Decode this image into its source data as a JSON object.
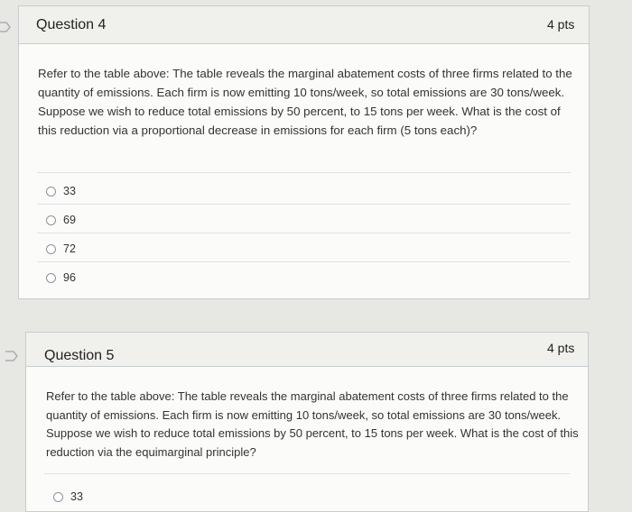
{
  "question4": {
    "title": "Question 4",
    "points": "4 pts",
    "text": "Refer to the table above: The table reveals the marginal abatement costs of three firms related to the quantity of emissions. Each firm is now emitting 10 tons/week, so total emissions are 30 tons/week. Suppose we wish to reduce total emissions by 50 percent, to 15 tons per week. What is the cost of this reduction via a proportional decrease in emissions for each firm (5 tons each)?",
    "options": [
      "33",
      "69",
      "72",
      "96"
    ]
  },
  "question5": {
    "title": "Question 5",
    "points": "4 pts",
    "text": "Refer to the table above: The table reveals the marginal abatement costs of three firms related to the quantity of emissions. Each firm is now emitting 10 tons/week, so total emissions are 30 tons/week. Suppose we wish to reduce total emissions by 50 percent, to 15 tons per week. What is the cost of this reduction via the equimarginal principle?",
    "options": [
      "33"
    ]
  },
  "icons": {
    "flag_q4": "flag-outline-icon",
    "flag_q5": "flag-outline-icon",
    "radio": "radio-unselected-icon"
  }
}
